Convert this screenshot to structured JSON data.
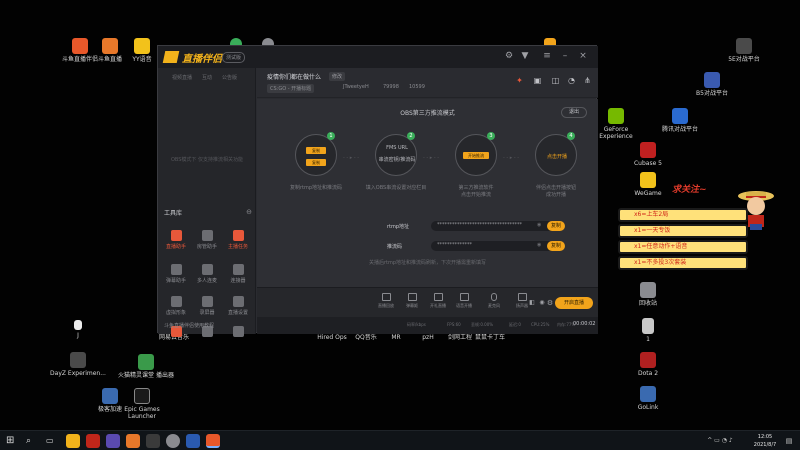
{
  "desktop": {
    "left_icons": [
      {
        "label": "斗鱼直播伴侣",
        "color": "#e8582a"
      },
      {
        "label": "斗鱼直播",
        "color": "#e8782a"
      },
      {
        "label": "YY语音",
        "color": "#f2c21b"
      },
      {
        "label": "",
        "color": "#3aae5a"
      },
      {
        "label": "",
        "color": "#8a8b90"
      }
    ],
    "row2_icons": [
      {
        "label": "网易云音乐",
        "color": "#d02020"
      },
      {
        "label": "Hired Ops",
        "color": "#4a4a4a"
      },
      {
        "label": "QQ音乐",
        "color": "#f2c21b"
      },
      {
        "label": "MR",
        "color": "#3a6ab0"
      },
      {
        "label": "pzH",
        "color": "#2a2a2a"
      },
      {
        "label": "剑网工程",
        "color": "#5a3a2a"
      },
      {
        "label": "鼠鼠卡丁车",
        "color": "#3aae5a"
      }
    ],
    "j_icon": {
      "label": "J"
    },
    "dayz": {
      "label": "DayZ Experimen..."
    },
    "huya": {
      "label": "火猫精灵课堂\n播出器"
    },
    "steam": {
      "label": "极客加速"
    },
    "epic": {
      "label": "Epic Games Launcher"
    },
    "right_icons": [
      {
        "label": "5E对战平台",
        "color": "#4a4a4a"
      },
      {
        "label": "B5对战平台",
        "color": "#3a5ab0"
      },
      {
        "label": "GeForce Experience",
        "color": "#76b900"
      },
      {
        "label": "腾讯对战平台",
        "color": "#2a6ad0"
      },
      {
        "label": "Cubase 5",
        "color": "#c02020"
      },
      {
        "label": "WeGame",
        "color": "#f2c21b"
      },
      {
        "label": "回收站",
        "color": "#8a8b90"
      },
      {
        "label": "1",
        "color": "#c8c8c8"
      },
      {
        "label": "Dota 2",
        "color": "#b02020"
      },
      {
        "label": "GoLink",
        "color": "#3a6ab0"
      }
    ],
    "top_icons": [
      {
        "label": "",
        "color": "#3aae5a"
      },
      {
        "label": "",
        "color": "#f2a41b"
      }
    ]
  },
  "app": {
    "brand": "直播伴侣",
    "version": "测试版",
    "side_tabs": [
      "视频直播",
      "互动",
      "公告版"
    ],
    "side_empty": "OBS模式下 仅支持推流相关功能",
    "tools_heading": "工具库",
    "tools": [
      {
        "label": "直播助手",
        "hot": true
      },
      {
        "label": "房管助手",
        "hot": false
      },
      {
        "label": "主播任务",
        "hot": true
      },
      {
        "label": "弹幕助手",
        "hot": false
      },
      {
        "label": "多人连麦",
        "hot": false
      },
      {
        "label": "连接器",
        "hot": false
      },
      {
        "label": "虚拟形象",
        "hot": false
      },
      {
        "label": "录屏器",
        "hot": false
      },
      {
        "label": "直播设置",
        "hot": false
      },
      {
        "label": "",
        "hot": false
      },
      {
        "label": "",
        "hot": false
      },
      {
        "label": "",
        "hot": false
      }
    ],
    "side_footer": "斗鱼直播伴侣使用教程",
    "header": {
      "title": "疫情你们都在做什么",
      "edit": "修改",
      "category": "CS:GO - 开播标题",
      "user": "JTweetyeH",
      "fans": "79998",
      "heat": "10599"
    },
    "main": {
      "mode_title": "OBS第三方推流模式",
      "exit": "退出",
      "steps": [
        {
          "num": "1",
          "chip": "复制",
          "chip2": "复制",
          "text": "",
          "caption": "复制rtmp地址和推流码"
        },
        {
          "num": "2",
          "chip": "",
          "chip2": "",
          "text": "FMS URL\n\n串流密钥/推流码",
          "caption": "填入OBS串流设置对应栏目"
        },
        {
          "num": "3",
          "chip": "开始推流",
          "chip2": "",
          "text": "",
          "caption": "第三方推流软件\n点击开始推流"
        },
        {
          "num": "4",
          "chip": "",
          "chip2": "",
          "text": "点击开播",
          "caption": "伴侣点击开播按钮\n成功开播"
        }
      ],
      "rtmp_label": "rtmp地址",
      "rtmp_value": "**********************************",
      "code_label": "推流码",
      "code_value": "**************",
      "copy_label": "复制",
      "hint": "关播后rtmp地址和推流码刷新，下次开播需重新填写"
    },
    "bottom_tools": [
      "直播回放",
      "弹幕姬",
      "开礼直播",
      "语音开播",
      "麦克风",
      "扬声器"
    ],
    "go_live": "开启直播",
    "status": {
      "bitrate": "码率/kbps",
      "fps": "FPS:60",
      "loss": "丢帧:0.00%",
      "delay": "延迟:0",
      "cpu": "CPU:25%",
      "mem": "内存:77%",
      "time": "00:00:02"
    }
  },
  "sticker": {
    "title": "求关注~",
    "rows": [
      "x6=上车2局",
      "x1=一天专饭",
      "x1=任意动作+语音",
      "x1=不多投3次套装"
    ]
  },
  "taskbar": {
    "time": "12:05",
    "date": "2021/8/7"
  }
}
